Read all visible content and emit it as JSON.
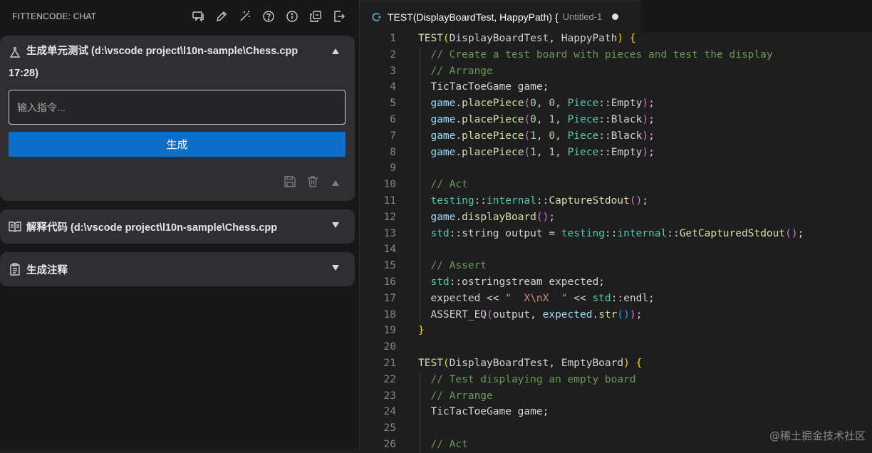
{
  "sidebar": {
    "title": "FITTENCODE: CHAT",
    "toolbar_icons": [
      "chat-icon",
      "pencil-icon",
      "magic-wand-icon",
      "help-icon",
      "info-icon",
      "copy-icon",
      "export-icon"
    ],
    "panels": {
      "test": {
        "title_line1": "生成单元测试 (d:\\vscode project\\l10n-sample\\Chess.cpp",
        "title_line2": "17:28)",
        "input_placeholder": "输入指令...",
        "button_label": "生成",
        "expanded": true
      },
      "explain": {
        "title": "解释代码 (d:\\vscode project\\l10n-sample\\Chess.cpp",
        "expanded": false
      },
      "comment": {
        "title": "生成注释",
        "expanded": false
      }
    }
  },
  "editor": {
    "tab": {
      "title": "TEST(DisplayBoardTest, HappyPath) {",
      "description": "Untitled-1",
      "dirty": true
    },
    "lines": [
      [
        [
          "k-fn",
          "TEST"
        ],
        [
          "k-brk",
          "("
        ],
        [
          "k-pl",
          "DisplayBoardTest, HappyPath"
        ],
        [
          "k-brk",
          ")"
        ],
        [
          "k-pl",
          " "
        ],
        [
          "k-brk",
          "{"
        ]
      ],
      [
        [
          "k-pl",
          "  "
        ],
        [
          "k-cm",
          "// Create a test board with pieces and test the display"
        ]
      ],
      [
        [
          "k-pl",
          "  "
        ],
        [
          "k-cm",
          "// Arrange"
        ]
      ],
      [
        [
          "k-pl",
          "  TicTacToeGame game;"
        ]
      ],
      [
        [
          "k-pl",
          "  "
        ],
        [
          "k-var",
          "game"
        ],
        [
          "k-pl",
          "."
        ],
        [
          "k-fn",
          "placePiece"
        ],
        [
          "k-brk2",
          "("
        ],
        [
          "k-num",
          "0"
        ],
        [
          "k-pl",
          ", "
        ],
        [
          "k-num",
          "0"
        ],
        [
          "k-pl",
          ", "
        ],
        [
          "k-ty",
          "Piece"
        ],
        [
          "k-pl",
          "::Empty"
        ],
        [
          "k-brk2",
          ")"
        ],
        [
          "k-pl",
          ";"
        ]
      ],
      [
        [
          "k-pl",
          "  "
        ],
        [
          "k-var",
          "game"
        ],
        [
          "k-pl",
          "."
        ],
        [
          "k-fn",
          "placePiece"
        ],
        [
          "k-brk2",
          "("
        ],
        [
          "k-num",
          "0"
        ],
        [
          "k-pl",
          ", "
        ],
        [
          "k-num",
          "1"
        ],
        [
          "k-pl",
          ", "
        ],
        [
          "k-ty",
          "Piece"
        ],
        [
          "k-pl",
          "::Black"
        ],
        [
          "k-brk2",
          ")"
        ],
        [
          "k-pl",
          ";"
        ]
      ],
      [
        [
          "k-pl",
          "  "
        ],
        [
          "k-var",
          "game"
        ],
        [
          "k-pl",
          "."
        ],
        [
          "k-fn",
          "placePiece"
        ],
        [
          "k-brk2",
          "("
        ],
        [
          "k-num",
          "1"
        ],
        [
          "k-pl",
          ", "
        ],
        [
          "k-num",
          "0"
        ],
        [
          "k-pl",
          ", "
        ],
        [
          "k-ty",
          "Piece"
        ],
        [
          "k-pl",
          "::Black"
        ],
        [
          "k-brk2",
          ")"
        ],
        [
          "k-pl",
          ";"
        ]
      ],
      [
        [
          "k-pl",
          "  "
        ],
        [
          "k-var",
          "game"
        ],
        [
          "k-pl",
          "."
        ],
        [
          "k-fn",
          "placePiece"
        ],
        [
          "k-brk2",
          "("
        ],
        [
          "k-num",
          "1"
        ],
        [
          "k-pl",
          ", "
        ],
        [
          "k-num",
          "1"
        ],
        [
          "k-pl",
          ", "
        ],
        [
          "k-ty",
          "Piece"
        ],
        [
          "k-pl",
          "::Empty"
        ],
        [
          "k-brk2",
          ")"
        ],
        [
          "k-pl",
          ";"
        ]
      ],
      [],
      [
        [
          "k-pl",
          "  "
        ],
        [
          "k-cm",
          "// Act"
        ]
      ],
      [
        [
          "k-pl",
          "  "
        ],
        [
          "k-ty",
          "testing"
        ],
        [
          "k-pl",
          "::"
        ],
        [
          "k-ty",
          "internal"
        ],
        [
          "k-pl",
          "::"
        ],
        [
          "k-fn",
          "CaptureStdout"
        ],
        [
          "k-brk2",
          "()"
        ],
        [
          "k-pl",
          ";"
        ]
      ],
      [
        [
          "k-pl",
          "  "
        ],
        [
          "k-var",
          "game"
        ],
        [
          "k-pl",
          "."
        ],
        [
          "k-fn",
          "displayBoard"
        ],
        [
          "k-brk2",
          "()"
        ],
        [
          "k-pl",
          ";"
        ]
      ],
      [
        [
          "k-pl",
          "  "
        ],
        [
          "k-ty",
          "std"
        ],
        [
          "k-pl",
          "::string output = "
        ],
        [
          "k-ty",
          "testing"
        ],
        [
          "k-pl",
          "::"
        ],
        [
          "k-ty",
          "internal"
        ],
        [
          "k-pl",
          "::"
        ],
        [
          "k-fn",
          "GetCapturedStdout"
        ],
        [
          "k-brk2",
          "()"
        ],
        [
          "k-pl",
          ";"
        ]
      ],
      [],
      [
        [
          "k-pl",
          "  "
        ],
        [
          "k-cm",
          "// Assert"
        ]
      ],
      [
        [
          "k-pl",
          "  "
        ],
        [
          "k-ty",
          "std"
        ],
        [
          "k-pl",
          "::ostringstream expected;"
        ]
      ],
      [
        [
          "k-pl",
          "  expected << "
        ],
        [
          "k-str",
          "\"  X\\nX  \""
        ],
        [
          "k-pl",
          " << "
        ],
        [
          "k-ty",
          "std"
        ],
        [
          "k-pl",
          "::endl;"
        ]
      ],
      [
        [
          "k-pl",
          "  ASSERT_EQ"
        ],
        [
          "k-brk2",
          "("
        ],
        [
          "k-pl",
          "output, "
        ],
        [
          "k-var",
          "expected"
        ],
        [
          "k-pl",
          "."
        ],
        [
          "k-fn",
          "str"
        ],
        [
          "k-brk3",
          "()"
        ],
        [
          "k-brk2",
          ")"
        ],
        [
          "k-pl",
          ";"
        ]
      ],
      [
        [
          "k-brk",
          "}"
        ]
      ],
      [],
      [
        [
          "k-fn",
          "TEST"
        ],
        [
          "k-brk",
          "("
        ],
        [
          "k-pl",
          "DisplayBoardTest, EmptyBoard"
        ],
        [
          "k-brk",
          ")"
        ],
        [
          "k-pl",
          " "
        ],
        [
          "k-brk",
          "{"
        ]
      ],
      [
        [
          "k-pl",
          "  "
        ],
        [
          "k-cm",
          "// Test displaying an empty board"
        ]
      ],
      [
        [
          "k-pl",
          "  "
        ],
        [
          "k-cm",
          "// Arrange"
        ]
      ],
      [
        [
          "k-pl",
          "  TicTacToeGame game;"
        ]
      ],
      [],
      [
        [
          "k-pl",
          "  "
        ],
        [
          "k-cm",
          "// Act"
        ]
      ]
    ]
  },
  "watermark": "@稀土掘金技术社区"
}
